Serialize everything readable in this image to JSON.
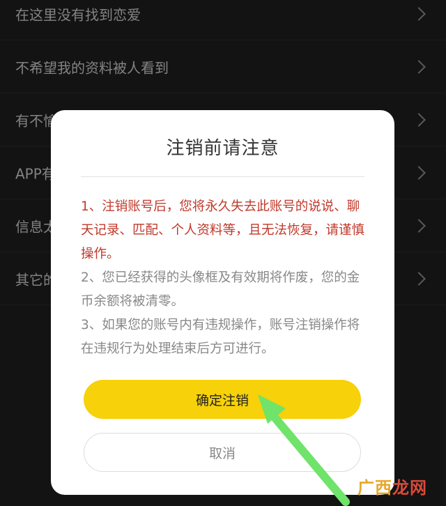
{
  "settings_list": {
    "items": [
      {
        "label": "在这里没有找到恋爱"
      },
      {
        "label": "不希望我的资料被人看到"
      },
      {
        "label": "有不愉"
      },
      {
        "label": "APP有"
      },
      {
        "label": "信息太"
      },
      {
        "label": "其它的"
      }
    ]
  },
  "dialog": {
    "title": "注销前请注意",
    "notes": {
      "item1": "1、注销账号后，您将永久失去此账号的说说、聊天记录、匹配、个人资料等，且无法恢复，请谨慎操作。",
      "item2": "2、您已经获得的头像框及有效期将作废，您的金币余额将被清零。",
      "item3": "3、如果您的账号内有违规操作，账号注销操作将在违规行为处理结束后方可进行。"
    },
    "confirm_label": "确定注销",
    "cancel_label": "取消"
  },
  "watermark": {
    "part1": "广西",
    "part2": "龙网"
  },
  "colors": {
    "background": "#1e1e1e",
    "warning_text": "#c0392b",
    "confirm_button": "#f7d10a",
    "pointer_arrow": "#6fe36a"
  },
  "icons": [
    "chevron-right-icon",
    "pointer-arrow-icon"
  ]
}
